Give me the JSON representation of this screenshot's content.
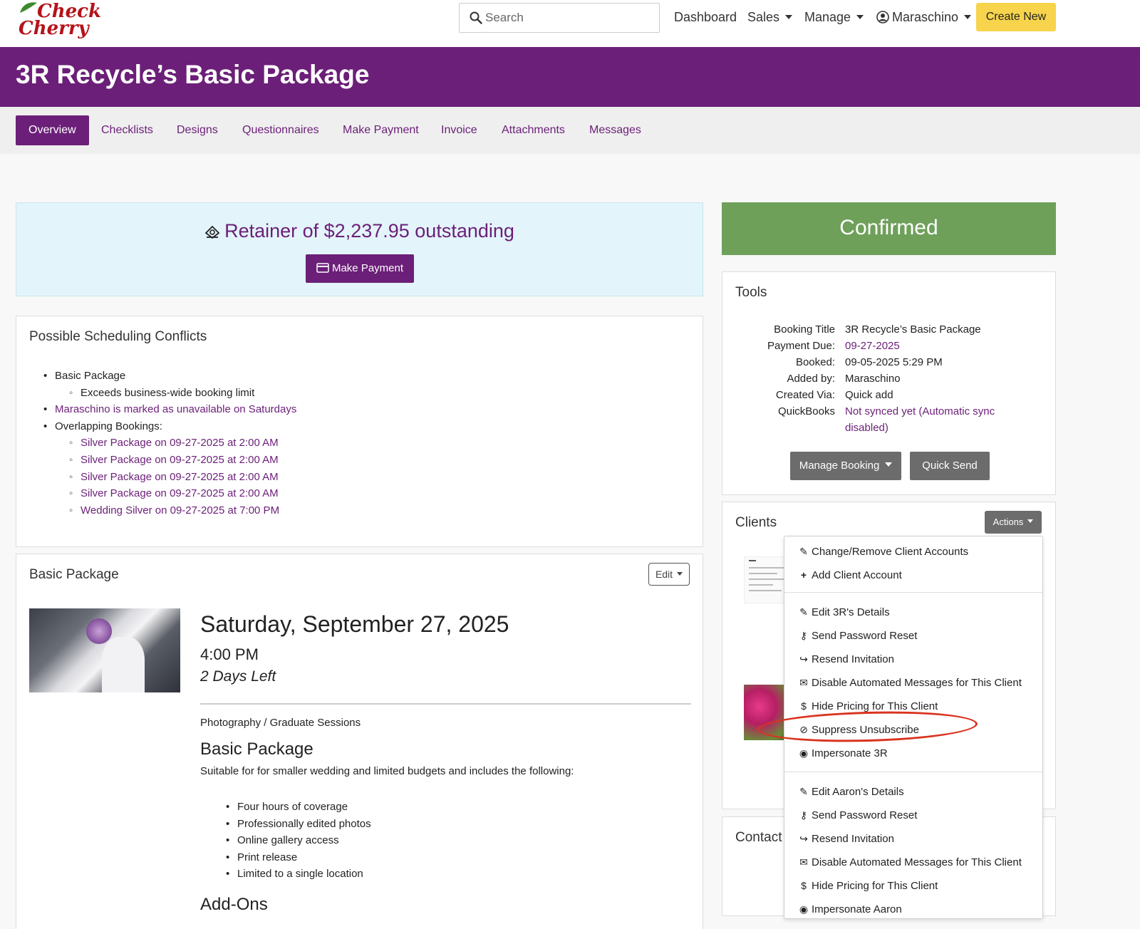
{
  "header": {
    "logo_line1": "Check",
    "logo_line2": "Cherry",
    "search_placeholder": "Search",
    "nav": {
      "dashboard": "Dashboard",
      "sales": "Sales",
      "manage": "Manage",
      "user": "Maraschino"
    },
    "create_new": "Create New"
  },
  "page": {
    "title": "3R Recycle’s Basic Package",
    "tabs": [
      "Overview",
      "Checklists",
      "Designs",
      "Questionnaires",
      "Make Payment",
      "Invoice",
      "Attachments",
      "Messages"
    ]
  },
  "retainer": {
    "text": "Retainer of $2,237.95 outstanding",
    "button": "Make Payment"
  },
  "status": "Confirmed",
  "conflicts": {
    "title": "Possible Scheduling Conflicts",
    "item1": "Basic Package",
    "item1_sub": "Exceeds business-wide booking limit",
    "item2": "Maraschino is marked as unavailable on Saturdays",
    "item3": "Overlapping Bookings:",
    "bookings": [
      "Silver Package on 09-27-2025 at 2:00 AM",
      "Silver Package on 09-27-2025 at 2:00 AM",
      "Silver Package on 09-27-2025 at 2:00 AM",
      "Silver Package on 09-27-2025 at 2:00 AM",
      "Wedding Silver on 09-27-2025 at 7:00 PM"
    ]
  },
  "package": {
    "panel_title": "Basic Package",
    "edit": "Edit",
    "date": "Saturday, September 27, 2025",
    "time": "4:00 PM",
    "days_left": "2 Days Left",
    "category": "Photography / Graduate Sessions",
    "name": "Basic Package",
    "description": "Suitable for for smaller wedding and limited budgets and includes the following:",
    "features": [
      "Four hours of coverage",
      "Professionally edited photos",
      "Online gallery access",
      "Print release",
      "Limited to a single location"
    ],
    "addons_title": "Add-Ons"
  },
  "tools": {
    "title": "Tools",
    "labels": {
      "booking_title": "Booking Title",
      "payment_due": "Payment Due:",
      "booked": "Booked:",
      "added_by": "Added by:",
      "created_via": "Created Via:",
      "quickbooks": "QuickBooks"
    },
    "values": {
      "booking_title": "3R Recycle’s Basic Package",
      "payment_due": "09-27-2025",
      "booked": "09-05-2025 5:29 PM",
      "added_by": "Maraschino",
      "created_via": "Quick add",
      "quickbooks_1": "Not synced yet (Automatic sync",
      "quickbooks_2": "disabled)"
    },
    "manage_booking": "Manage Booking",
    "quick_send": "Quick Send"
  },
  "clients": {
    "title": "Clients",
    "actions": "Actions",
    "contacts_title": "Contact"
  },
  "menu": {
    "change_remove": "Change/Remove Client Accounts",
    "add_client": "Add Client Account",
    "edit_3r": "Edit 3R's Details",
    "pw_reset_1": "Send Password Reset",
    "resend_1": "Resend Invitation",
    "disable_1": "Disable Automated Messages for This Client",
    "hide_pricing_1": "Hide Pricing for This Client",
    "suppress": "Suppress Unsubscribe",
    "impersonate_3r": "Impersonate 3R",
    "edit_aaron": "Edit Aaron's Details",
    "pw_reset_2": "Send Password Reset",
    "resend_2": "Resend Invitation",
    "disable_2": "Disable Automated Messages for This Client",
    "hide_pricing_2": "Hide Pricing for This Client",
    "impersonate_aaron": "Impersonate Aaron"
  },
  "colors": {
    "brand_purple": "#6b1f78",
    "confirmed_green": "#6fa05a",
    "create_yellow": "#f7d44c",
    "annotation_red": "#d9331f"
  }
}
